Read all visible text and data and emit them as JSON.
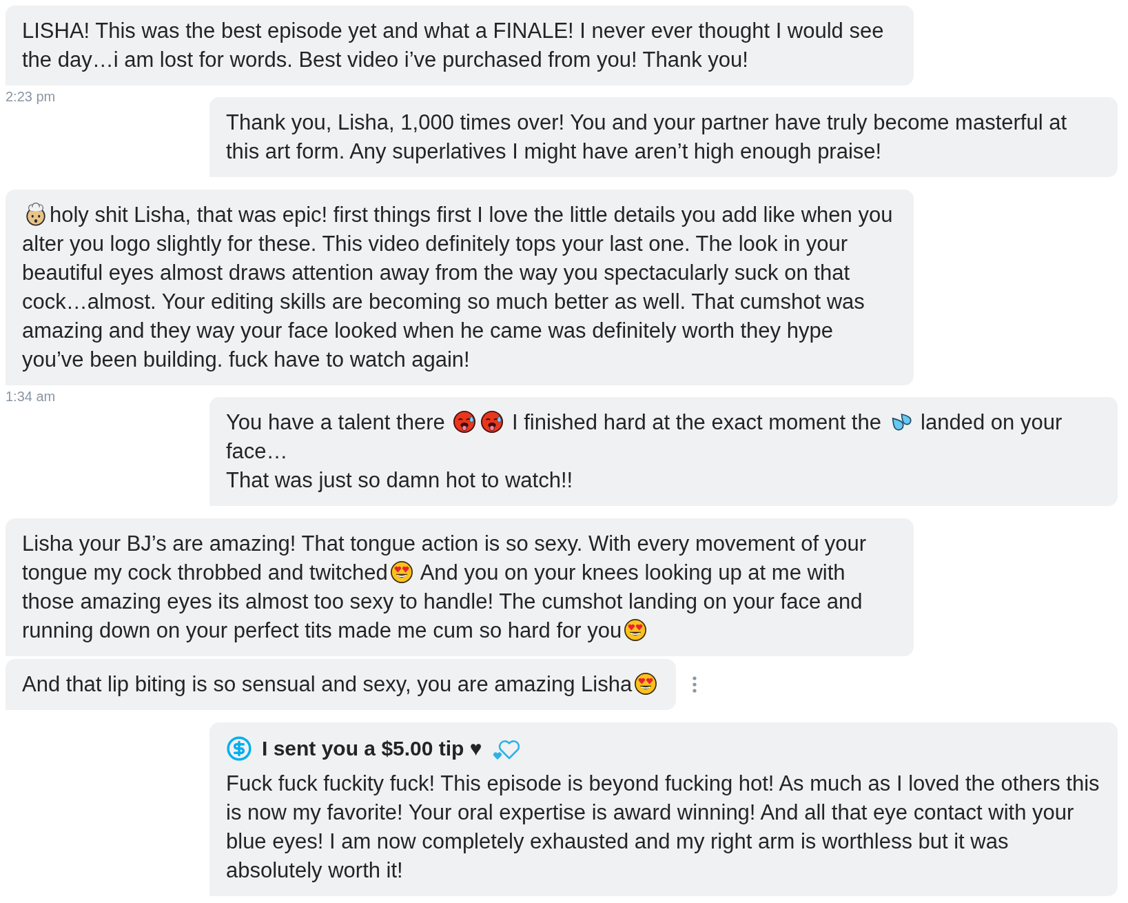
{
  "messages": [
    {
      "kind": "incoming",
      "hovered": false,
      "time": "2:23 pm",
      "parts": [
        {
          "kind": "text",
          "text": "LISHA! This was the best episode yet and what a FINALE! I never ever thought I would see the day…i am lost for words. Best video i’ve purchased from you! Thank you!"
        }
      ]
    },
    {
      "kind": "outgoing",
      "hovered": false,
      "parts": [
        {
          "kind": "text",
          "text": "Thank you, Lisha, 1,000 times over! You and your partner have truly become masterful at this art form. Any superlatives I might have aren’t high enough praise!"
        }
      ]
    },
    {
      "kind": "incoming",
      "hovered": false,
      "time": "1:34 am",
      "parts": [
        {
          "kind": "mind_blown"
        },
        {
          "kind": "text",
          "text": "holy shit Lisha, that was epic! first things first I love the little details you add like when you alter you logo slightly for these. This video definitely tops your last one. The look in your beautiful eyes almost draws attention away from the way you spectacularly suck on that cock…almost. Your editing skills are becoming so much better as well. That cumshot was amazing and they way your face looked when he came was definitely worth they hype you’ve been building. fuck have to watch again!"
        }
      ]
    },
    {
      "kind": "outgoing",
      "hovered": false,
      "parts": [
        {
          "kind": "text",
          "text": "You have a talent there "
        },
        {
          "kind": "hot_face"
        },
        {
          "kind": "hot_face"
        },
        {
          "kind": "text",
          "text": " I finished hard at the exact moment the "
        },
        {
          "kind": "sweat_droplets"
        },
        {
          "kind": "text",
          "text": " landed on your face…\nThat was just so damn hot to watch!!"
        }
      ]
    },
    {
      "kind": "incoming",
      "hovered": false,
      "parts": [
        {
          "kind": "text",
          "text": "Lisha your BJ’s are amazing! That tongue action is so sexy. With every movement of your tongue my cock throbbed and twitched"
        },
        {
          "kind": "heart_eyes"
        },
        {
          "kind": "text",
          "text": " And you on your knees looking up at me with those amazing eyes its almost too sexy to handle! The cumshot landing on your face and running down on your perfect tits made me cum so hard for you"
        },
        {
          "kind": "heart_eyes"
        }
      ]
    },
    {
      "kind": "incoming",
      "hovered": true,
      "parts": [
        {
          "kind": "text",
          "text": "And that lip biting is so sensual and sexy, you are amazing Lisha"
        },
        {
          "kind": "heart_eyes"
        }
      ]
    },
    {
      "kind": "tip",
      "hovered": false,
      "tip_label": "I sent you a $5.00 tip ♥",
      "parts": [
        {
          "kind": "text",
          "text": "Fuck fuck fuckity fuck! This episode is beyond fucking hot! As much as I loved the others this is now my favorite! Your oral expertise is award winning! And all that eye contact with your blue eyes! I am now completely exhausted and my right arm is worthless but it was absolutely worth it!"
        }
      ]
    }
  ]
}
